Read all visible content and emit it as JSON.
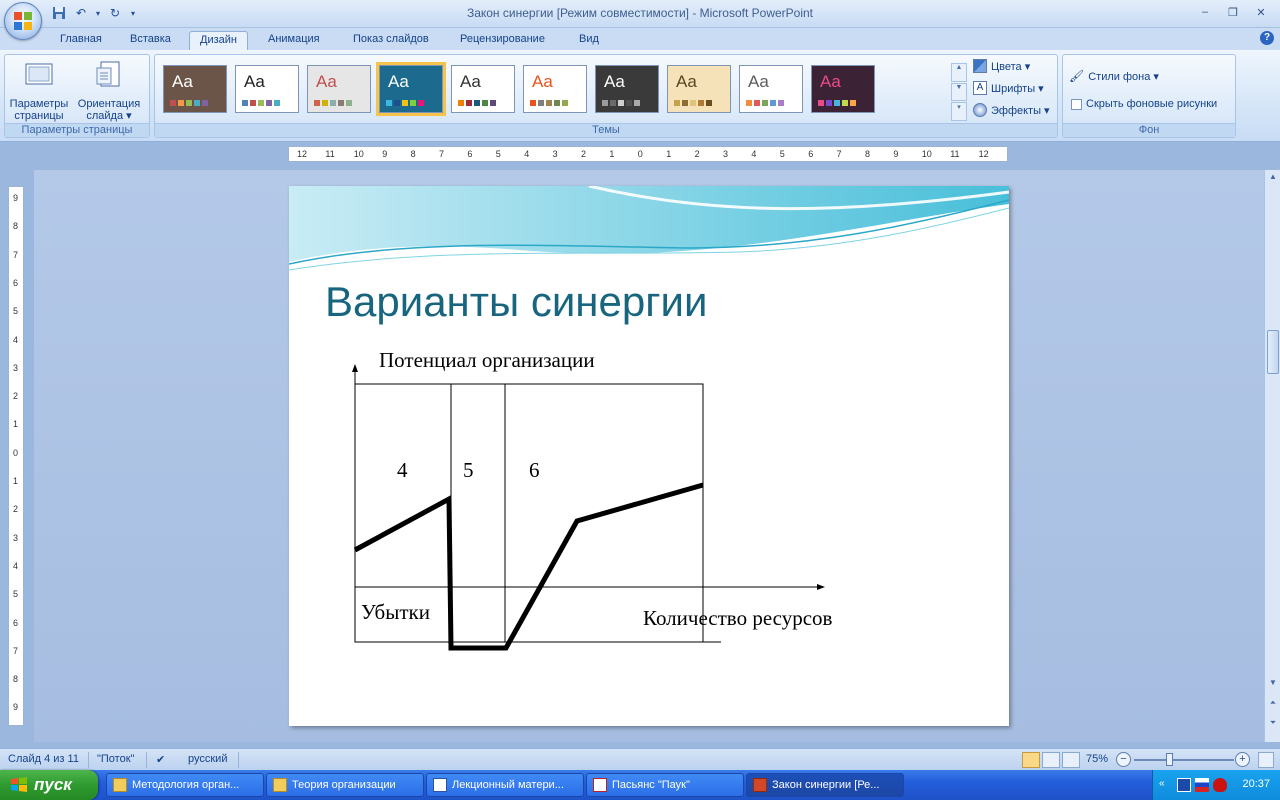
{
  "window": {
    "title": "Закон синергии [Режим совместимости] - Microsoft PowerPoint"
  },
  "tabs": [
    "Главная",
    "Вставка",
    "Дизайн",
    "Анимация",
    "Показ слайдов",
    "Рецензирование",
    "Вид"
  ],
  "active_tab": "Дизайн",
  "ribbon": {
    "page_setup": {
      "btn1_line1": "Параметры",
      "btn1_line2": "страницы",
      "btn2_line1": "Ориентация",
      "btn2_line2": "слайда ▾",
      "label": "Параметры страницы"
    },
    "themes": {
      "label": "Темы",
      "items": [
        {
          "text": "Aa",
          "bg": "#6b5548",
          "fg": "#ffffff"
        },
        {
          "text": "Aa",
          "bg": "#ffffff",
          "fg": "#222222"
        },
        {
          "text": "Aa",
          "bg": "#e6e6e6",
          "fg": "#c0504d"
        },
        {
          "text": "Aa",
          "bg": "#1d6a8f",
          "fg": "#ffffff"
        },
        {
          "text": "Aa",
          "bg": "#ffffff",
          "fg": "#333333"
        },
        {
          "text": "Aa",
          "bg": "#ffffff",
          "fg": "#e8531f"
        },
        {
          "text": "Aa",
          "bg": "#3a3a3a",
          "fg": "#ffffff"
        },
        {
          "text": "Aa",
          "bg": "#f5e2b8",
          "fg": "#5a4522"
        },
        {
          "text": "Aa",
          "bg": "#ffffff",
          "fg": "#5c5c5c"
        },
        {
          "text": "Aa",
          "bg": "#3b2234",
          "fg": "#e94b8a"
        }
      ],
      "selected_index": 3
    },
    "colors": "Цвета ▾",
    "fonts": "Шрифты ▾",
    "effects": "Эффекты ▾",
    "background": {
      "styles": "Стили фона ▾",
      "hide_graphics": "Скрыть фоновые рисунки",
      "label": "Фон"
    }
  },
  "ruler": {
    "h_labels": [
      "12",
      "11",
      "10",
      "9",
      "8",
      "7",
      "6",
      "5",
      "4",
      "3",
      "2",
      "1",
      "0",
      "1",
      "2",
      "3",
      "4",
      "5",
      "6",
      "7",
      "8",
      "9",
      "10",
      "11",
      "12"
    ],
    "v_labels": [
      "9",
      "8",
      "7",
      "6",
      "5",
      "4",
      "3",
      "2",
      "1",
      "0",
      "1",
      "2",
      "3",
      "4",
      "5",
      "6",
      "7",
      "8",
      "9"
    ]
  },
  "slide": {
    "title": "Варианты синергии",
    "y_axis_label": "Потенциал организации",
    "x_axis_label": "Количество ресурсов",
    "losses_label": "Убытки",
    "zone_4": "4",
    "zone_5": "5",
    "zone_6": "6"
  },
  "status": {
    "slide_counter": "Слайд 4 из 11",
    "theme_name": "\"Поток\"",
    "language": "русский",
    "zoom": "75%"
  },
  "taskbar": {
    "start": "пуск",
    "tasks": [
      "Методология орган...",
      "Теория организации",
      "Лекционный матери...",
      "Пасьянс \"Паук\"",
      "Закон синергии [Ре..."
    ],
    "clock": "20:37"
  },
  "colors": {
    "title": "#17657e",
    "ribbon_text": "#15428b",
    "taskbar": "#245edb",
    "start": "#2f9b2f"
  }
}
